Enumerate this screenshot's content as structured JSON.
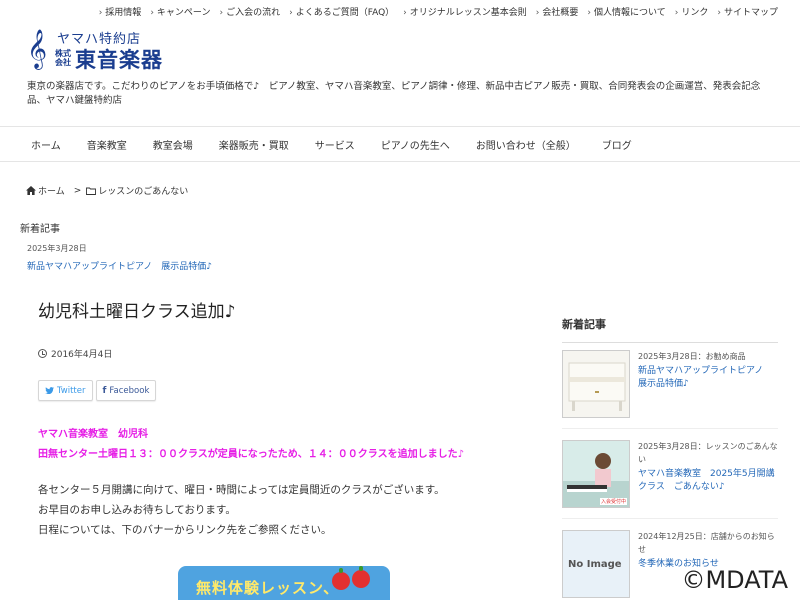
{
  "topnav": [
    "採用情報",
    "キャンペーン",
    "ご入会の流れ",
    "よくあるご質問（FAQ）",
    "オリジナルレッスン基本会則",
    "会社概要",
    "個人情報について",
    "リンク",
    "サイトマップ"
  ],
  "logo": {
    "clef": "𝄞",
    "subtitle": "ヤマハ特約店",
    "kabushiki": "株式会社",
    "name": "東音楽器"
  },
  "description": "東京の楽器店です。こだわりのピアノをお手頃価格で♪　ピアノ教室、ヤマハ音楽教室、ピアノ調律・修理、新品中古ピアノ販売・買取、合同発表会の企画運営、発表会記念品、ヤマハ鍵盤特約店",
  "gnav": [
    "ホーム",
    "音楽教室",
    "教室会場",
    "楽器販売・買取",
    "サービス",
    "ピアノの先生へ",
    "お問い合わせ（全般）",
    "ブログ"
  ],
  "breadcrumb": {
    "home": "ホーム",
    "sep": ">",
    "category": "レッスンのごあんない"
  },
  "newsbox": {
    "heading": "新着記事",
    "date": "2025年3月28日",
    "link": "新品ヤマハアップライトピアノ　展示品特価♪"
  },
  "post": {
    "title": "幼児科土曜日クラス追加♪",
    "date": "2016年4月4日",
    "share": {
      "twitter": "Twitter",
      "facebook": "Facebook"
    },
    "highlight1": "ヤマハ音楽教室　幼児科",
    "highlight2": "田無センター土曜日１３：００クラスが定員になったため、１４：００クラスを追加しました♪",
    "body": [
      "各センター５月開講に向けて、曜日・時間によっては定員間近のクラスがございます。",
      "お早目のお申し込みお待ちしております。",
      "日程については、下のバナーからリンク先をご参照ください。"
    ],
    "banner": "無料体験レッスン、"
  },
  "sidebar": {
    "heading": "新着記事",
    "items": [
      {
        "meta": "2025年3月28日：お勧め商品",
        "title": "新品ヤマハアップライトピアノ　展示品特価♪"
      },
      {
        "meta": "2025年3月28日：レッスンのごあんない",
        "title": "ヤマハ音楽教室　2025年5月開講クラス　ごあんない♪",
        "thumb_caption": "入会受付中"
      },
      {
        "meta": "2024年12月25日：店舗からのお知らせ",
        "title": "冬季休業のお知らせ",
        "thumb_text": "No Image"
      }
    ]
  },
  "copyright": "©MDATA",
  "colors": {
    "accent": "#1a3d8f",
    "link": "#2468b8",
    "highlight": "#e61ee6"
  }
}
